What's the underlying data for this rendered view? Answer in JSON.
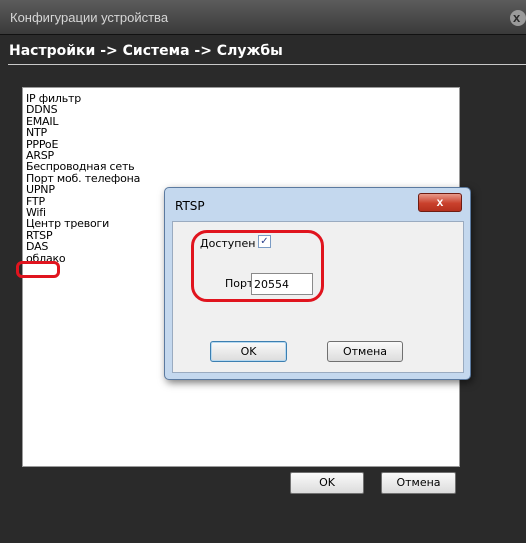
{
  "window": {
    "title": "Конфигурации устройства",
    "close_symbol": "x"
  },
  "breadcrumb": "Настройки -> Система -> Службы",
  "services": [
    "IP фильтр",
    "DDNS",
    "EMAIL",
    "NTP",
    "PPPoE",
    "ARSP",
    "Беспроводная сеть",
    "Порт моб. телефона",
    "UPNP",
    "FTP",
    "Wifi",
    "Центр тревоги",
    "RTSP",
    "DAS",
    "облако"
  ],
  "main_buttons": {
    "ok": "OK",
    "cancel": "Отмена"
  },
  "dialog": {
    "title": "RTSP",
    "close_symbol": "x",
    "enabled_label": "Доступен",
    "enabled_checked": true,
    "checkmark": "✓",
    "port_label": "Порт",
    "port_value": "20554",
    "ok": "OK",
    "cancel": "Отмена"
  },
  "colors": {
    "highlight": "#e0141e",
    "dialog_frame": "#c4d8ee",
    "close_button": "#c9402c"
  }
}
